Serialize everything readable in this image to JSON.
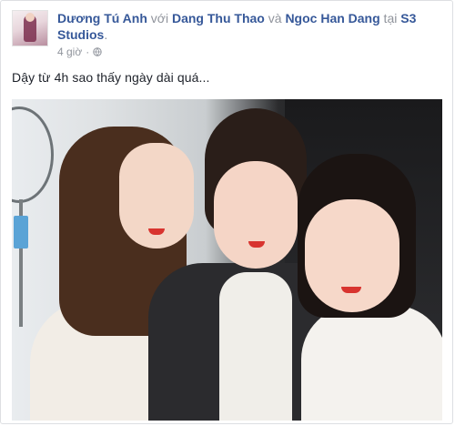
{
  "post": {
    "author": "Dương Tú Anh",
    "with_text": " với ",
    "tagged_1": "Dang Thu Thao",
    "and_text": " và ",
    "tagged_2": "Ngoc Han Dang",
    "at_text": " tại ",
    "location": "S3 Studios",
    "location_suffix": ".",
    "time": "4 giờ",
    "separator": "·",
    "privacy_icon": "globe-icon",
    "text": "Dậy từ 4h sao thấy ngày dài quá..."
  },
  "colors": {
    "link": "#365899",
    "muted": "#90949c",
    "text": "#1d2129",
    "border": "#dddfe2"
  }
}
